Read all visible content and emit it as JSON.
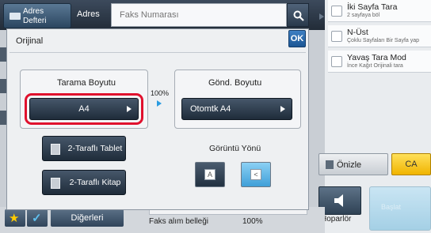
{
  "topbar": {
    "address_book_label": "Adres Defteri",
    "address_label": "Adres",
    "fax_placeholder": "Faks Numarası",
    "search_icon": "search-icon"
  },
  "modes": [
    {
      "title": "İki Sayfa Tara",
      "subtitle": "2 sayfaya böl"
    },
    {
      "title": "N-Üst",
      "subtitle": "Çoklu Sayfaları Bir Sayfa yap"
    },
    {
      "title": "Yavaş Tara Mod",
      "subtitle": "İnce Kağıt Orijinali tara"
    }
  ],
  "dialog": {
    "title": "Orijinal",
    "ok_label": "OK",
    "scan_size": {
      "title": "Tarama Boyutu",
      "value": "A4"
    },
    "ratio": "100%",
    "send_size": {
      "title": "Gönd. Boyutu",
      "value": "Otomtk  A4"
    },
    "duplex_tablet": "2-Taraflı Tablet",
    "duplex_book": "2-Taraflı Kitap",
    "orientation_title": "Görüntü Yönü",
    "orientation_portrait_glyph": "A",
    "orientation_landscape_glyph": "<"
  },
  "actions": {
    "preview_label": "Önizle",
    "ca_label": "CA",
    "speaker_label": "Hoparlör",
    "start_label": "Başlat"
  },
  "bottom": {
    "others_label": "Diğerleri",
    "memory_label": "Faks alım belleği",
    "memory_value": "100%"
  },
  "colors": {
    "accent_blue": "#2a9be0",
    "highlight_red": "#e0102d",
    "ca_yellow": "#f0b400",
    "selected_orientation": "#5fb7ea"
  }
}
